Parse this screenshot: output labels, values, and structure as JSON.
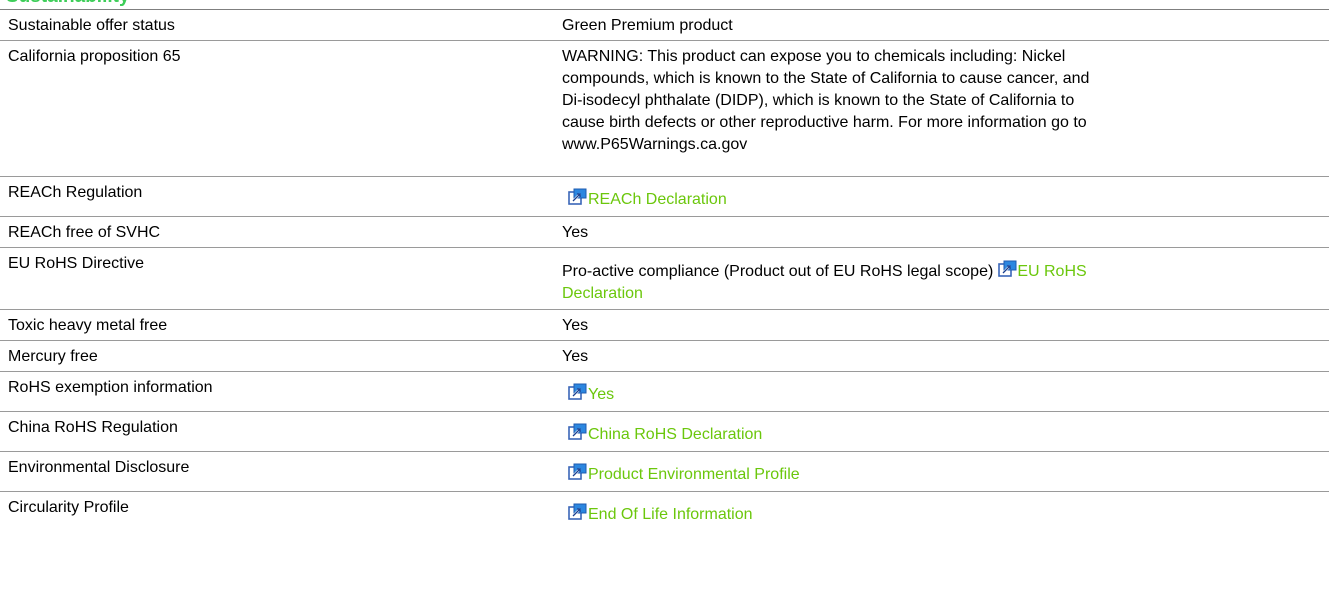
{
  "section": {
    "title": "Sustainability"
  },
  "link_color": "#6bc70c",
  "icon_name": "external-link-icon",
  "rows": {
    "sustainable_offer": {
      "label": "Sustainable offer status",
      "value": "Green Premium product"
    },
    "prop65": {
      "label": "California proposition 65",
      "value_lines": [
        "WARNING: This product can expose you to chemicals including: Nickel",
        "compounds, which is known to the State of California to cause cancer, and",
        "Di-isodecyl phthalate (DIDP), which is known to the State of California to",
        "cause birth defects or other reproductive harm. For more information go to",
        "www.P65Warnings.ca.gov"
      ]
    },
    "reach_regulation": {
      "label": "REACh Regulation",
      "link_text": "REACh Declaration"
    },
    "reach_svhc": {
      "label": "REACh free of SVHC",
      "value": "Yes"
    },
    "eu_rohs": {
      "label": "EU RoHS Directive",
      "value": "Pro-active compliance (Product out of EU RoHS legal scope)",
      "link_text_line1": "EU RoHS",
      "link_text_line2": "Declaration"
    },
    "toxic_metal": {
      "label": "Toxic heavy metal free",
      "value": "Yes"
    },
    "mercury": {
      "label": "Mercury free",
      "value": "Yes"
    },
    "rohs_exemption": {
      "label": "RoHS exemption information",
      "link_text": "Yes"
    },
    "china_rohs": {
      "label": "China RoHS Regulation",
      "link_text": "China RoHS Declaration"
    },
    "environmental": {
      "label": "Environmental Disclosure",
      "link_text": "Product Environmental Profile"
    },
    "circularity": {
      "label": "Circularity Profile",
      "link_text": "End Of Life Information"
    }
  }
}
